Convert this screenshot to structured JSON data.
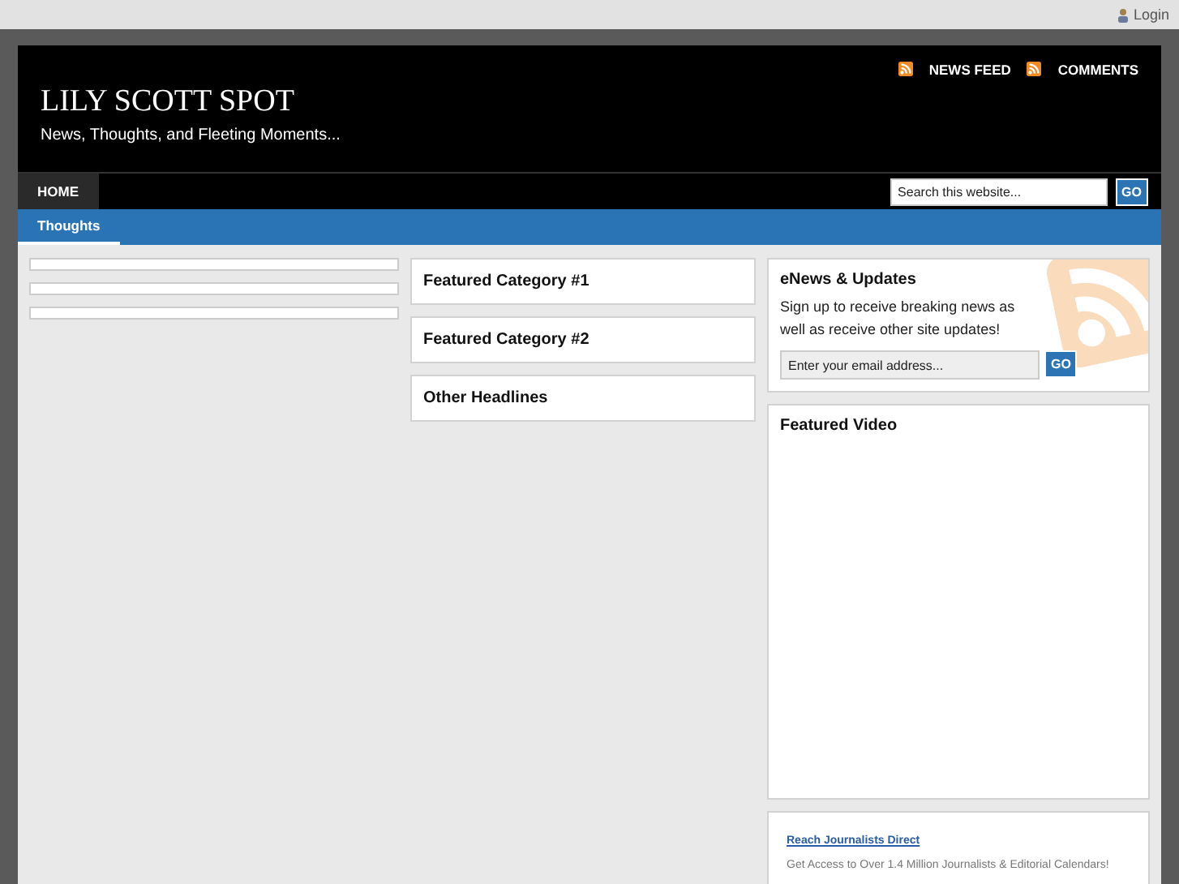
{
  "topbar": {
    "login": "Login"
  },
  "header": {
    "title": "LILY SCOTT SPOT",
    "tagline": "News, Thoughts, and Fleeting Moments...",
    "feeds": [
      "NEWS FEED",
      "COMMENTS"
    ]
  },
  "nav": {
    "items": [
      {
        "label": "HOME",
        "selected": true
      }
    ],
    "search": {
      "placeholder": "Search this website...",
      "button": "GO"
    }
  },
  "subnav": {
    "items": [
      {
        "label": "Thoughts",
        "selected": true
      }
    ]
  },
  "left": {
    "widgets": [
      {
        "kind": "empty"
      },
      {
        "kind": "empty"
      },
      {
        "kind": "empty"
      }
    ]
  },
  "middle": {
    "widgets": [
      "Featured Category #1",
      "Featured Category #2",
      "Other Headlines"
    ]
  },
  "right": {
    "enews": {
      "title": "eNews & Updates",
      "text": "Sign up to receive breaking news as well as receive other site updates!",
      "placeholder": "Enter your email address...",
      "button": "GO"
    },
    "video": {
      "title": "Featured Video"
    },
    "ad": {
      "link": "Reach Journalists Direct",
      "text": "Get Access to Over 1.4 Million Journalists & Editorial Calendars!"
    }
  }
}
